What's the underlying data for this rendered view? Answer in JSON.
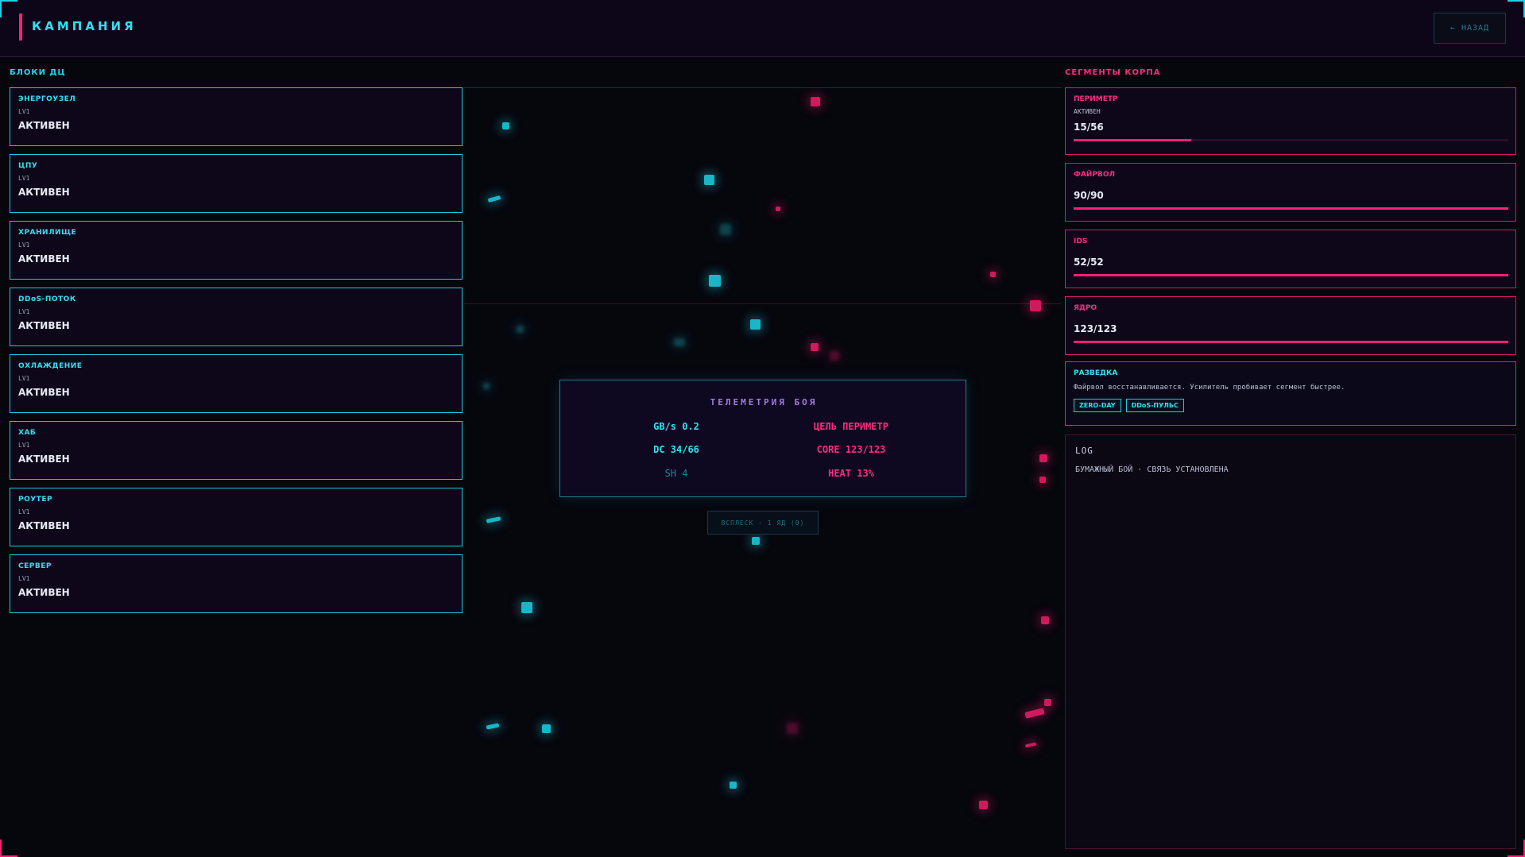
{
  "header": {
    "title": "КАМПАНИЯ",
    "back_label": "← НАЗАД"
  },
  "left_panel": {
    "label": "БЛОКИ ДЦ",
    "blocks": [
      {
        "name": "ЭНЕРГОУЗЕЛ",
        "level": "LV1",
        "state": "АКТИВЕН"
      },
      {
        "name": "ЦПУ",
        "level": "LV1",
        "state": "АКТИВЕН"
      },
      {
        "name": "ХРАНИЛИЩЕ",
        "level": "LV1",
        "state": "АКТИВЕН"
      },
      {
        "name": "DDoS-ПОТОК",
        "level": "LV1",
        "state": "АКТИВЕН"
      },
      {
        "name": "ОХЛАЖДЕНИЕ",
        "level": "LV1",
        "state": "АКТИВЕН"
      },
      {
        "name": "ХАБ",
        "level": "LV1",
        "state": "АКТИВЕН"
      },
      {
        "name": "РОУТЕР",
        "level": "LV1",
        "state": "АКТИВЕН"
      },
      {
        "name": "СЕРВЕР",
        "level": "LV1",
        "state": "АКТИВЕН"
      }
    ]
  },
  "right_panel": {
    "label": "СЕГМЕНТЫ КОРПА",
    "segments": [
      {
        "name": "ПЕРИМЕТР",
        "status": "АКТИВЕН",
        "value": "15/56",
        "fill": 0.27
      },
      {
        "name": "ФАЙРВОЛ",
        "status": "",
        "value": "90/90",
        "fill": 1.0
      },
      {
        "name": "IDS",
        "status": "",
        "value": "52/52",
        "fill": 1.0
      },
      {
        "name": "ЯДРО",
        "status": "",
        "value": "123/123",
        "fill": 1.0
      }
    ],
    "recon": {
      "name": "РАЗВЕДКА",
      "text": "Файрвол восстанавливается. Усилитель пробивает сегмент быстрее.",
      "tags": [
        "ZERO-DAY",
        "DDoS-ПУЛЬС"
      ]
    },
    "log": {
      "title": "LOG",
      "lines": [
        "БУМАЖНЫЙ БОЙ · СВЯЗЬ УСТАНОВЛЕНА"
      ]
    }
  },
  "telemetry": {
    "title": "ТЕЛЕМЕТРИЯ БОЯ",
    "gbs": "GB/s 0.2",
    "target": "ЦЕЛЬ ПЕРИМЕТР",
    "dc": "DC 34/66",
    "core": "CORE 123/123",
    "sh": "SH 4",
    "heat": "HEAT 13%"
  },
  "surge_button": {
    "label": "ВСПЛЕСК · 1 ЯД (0)"
  },
  "colors": {
    "cyan": "#33e0f0",
    "magenta": "#ff2a7f",
    "background": "#06060d",
    "panel": "#0d0719"
  }
}
